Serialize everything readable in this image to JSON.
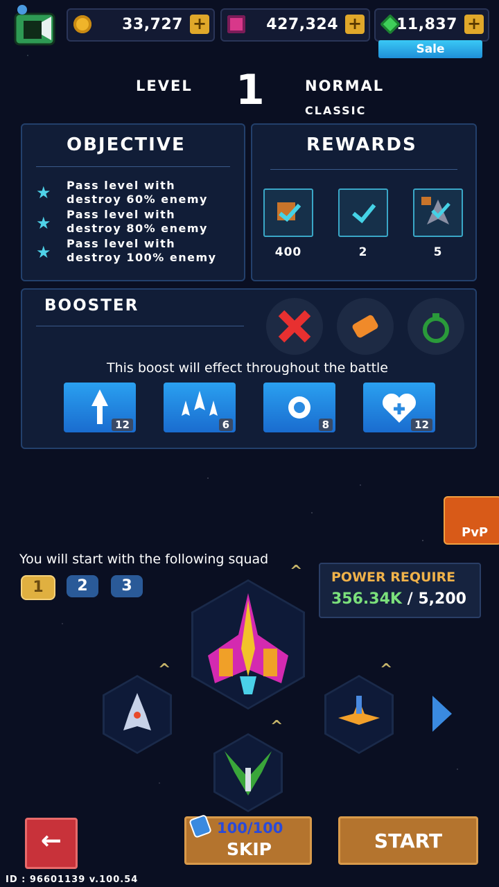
{
  "topbar": {
    "coins": "33,727",
    "tickets": "427,324",
    "gems": "11,837",
    "sale_label": "Sale"
  },
  "level": {
    "label": "LEVEL",
    "number": "1",
    "mode": "NORMAL",
    "type": "CLASSIC"
  },
  "objective": {
    "title": "OBJECTIVE",
    "items": [
      {
        "line1": "Pass level with",
        "line2": "destroy 60% enemy"
      },
      {
        "line1": "Pass level with",
        "line2": "destroy 80% enemy"
      },
      {
        "line1": "Pass level with",
        "line2": "destroy 100% enemy"
      }
    ]
  },
  "rewards": {
    "title": "REWARDS",
    "items": [
      {
        "amount": "400"
      },
      {
        "amount": "2"
      },
      {
        "amount": "5"
      }
    ]
  },
  "booster": {
    "title": "BOOSTER",
    "description": "This boost will effect throughout the battle",
    "items": [
      {
        "count": "12"
      },
      {
        "count": "6"
      },
      {
        "count": "8"
      },
      {
        "count": "12"
      }
    ]
  },
  "pvp_label": "PvP",
  "squad": {
    "caption": "You will start with the following squad",
    "tabs": [
      "1",
      "2",
      "3"
    ]
  },
  "power": {
    "label": "POWER REQUIRE",
    "current": "356.34K",
    "separator": "/",
    "required": "5,200"
  },
  "buttons": {
    "skip_count": "100/100",
    "skip": "SKIP",
    "start": "START",
    "back_arrow": "←"
  },
  "footer": {
    "id_text": "ID : 96601139 v.100.54"
  },
  "colors": {
    "accent_cyan": "#4fd2e8",
    "power_green": "#7be07b",
    "power_label": "#f0b24a",
    "back_red": "#c8323a"
  }
}
